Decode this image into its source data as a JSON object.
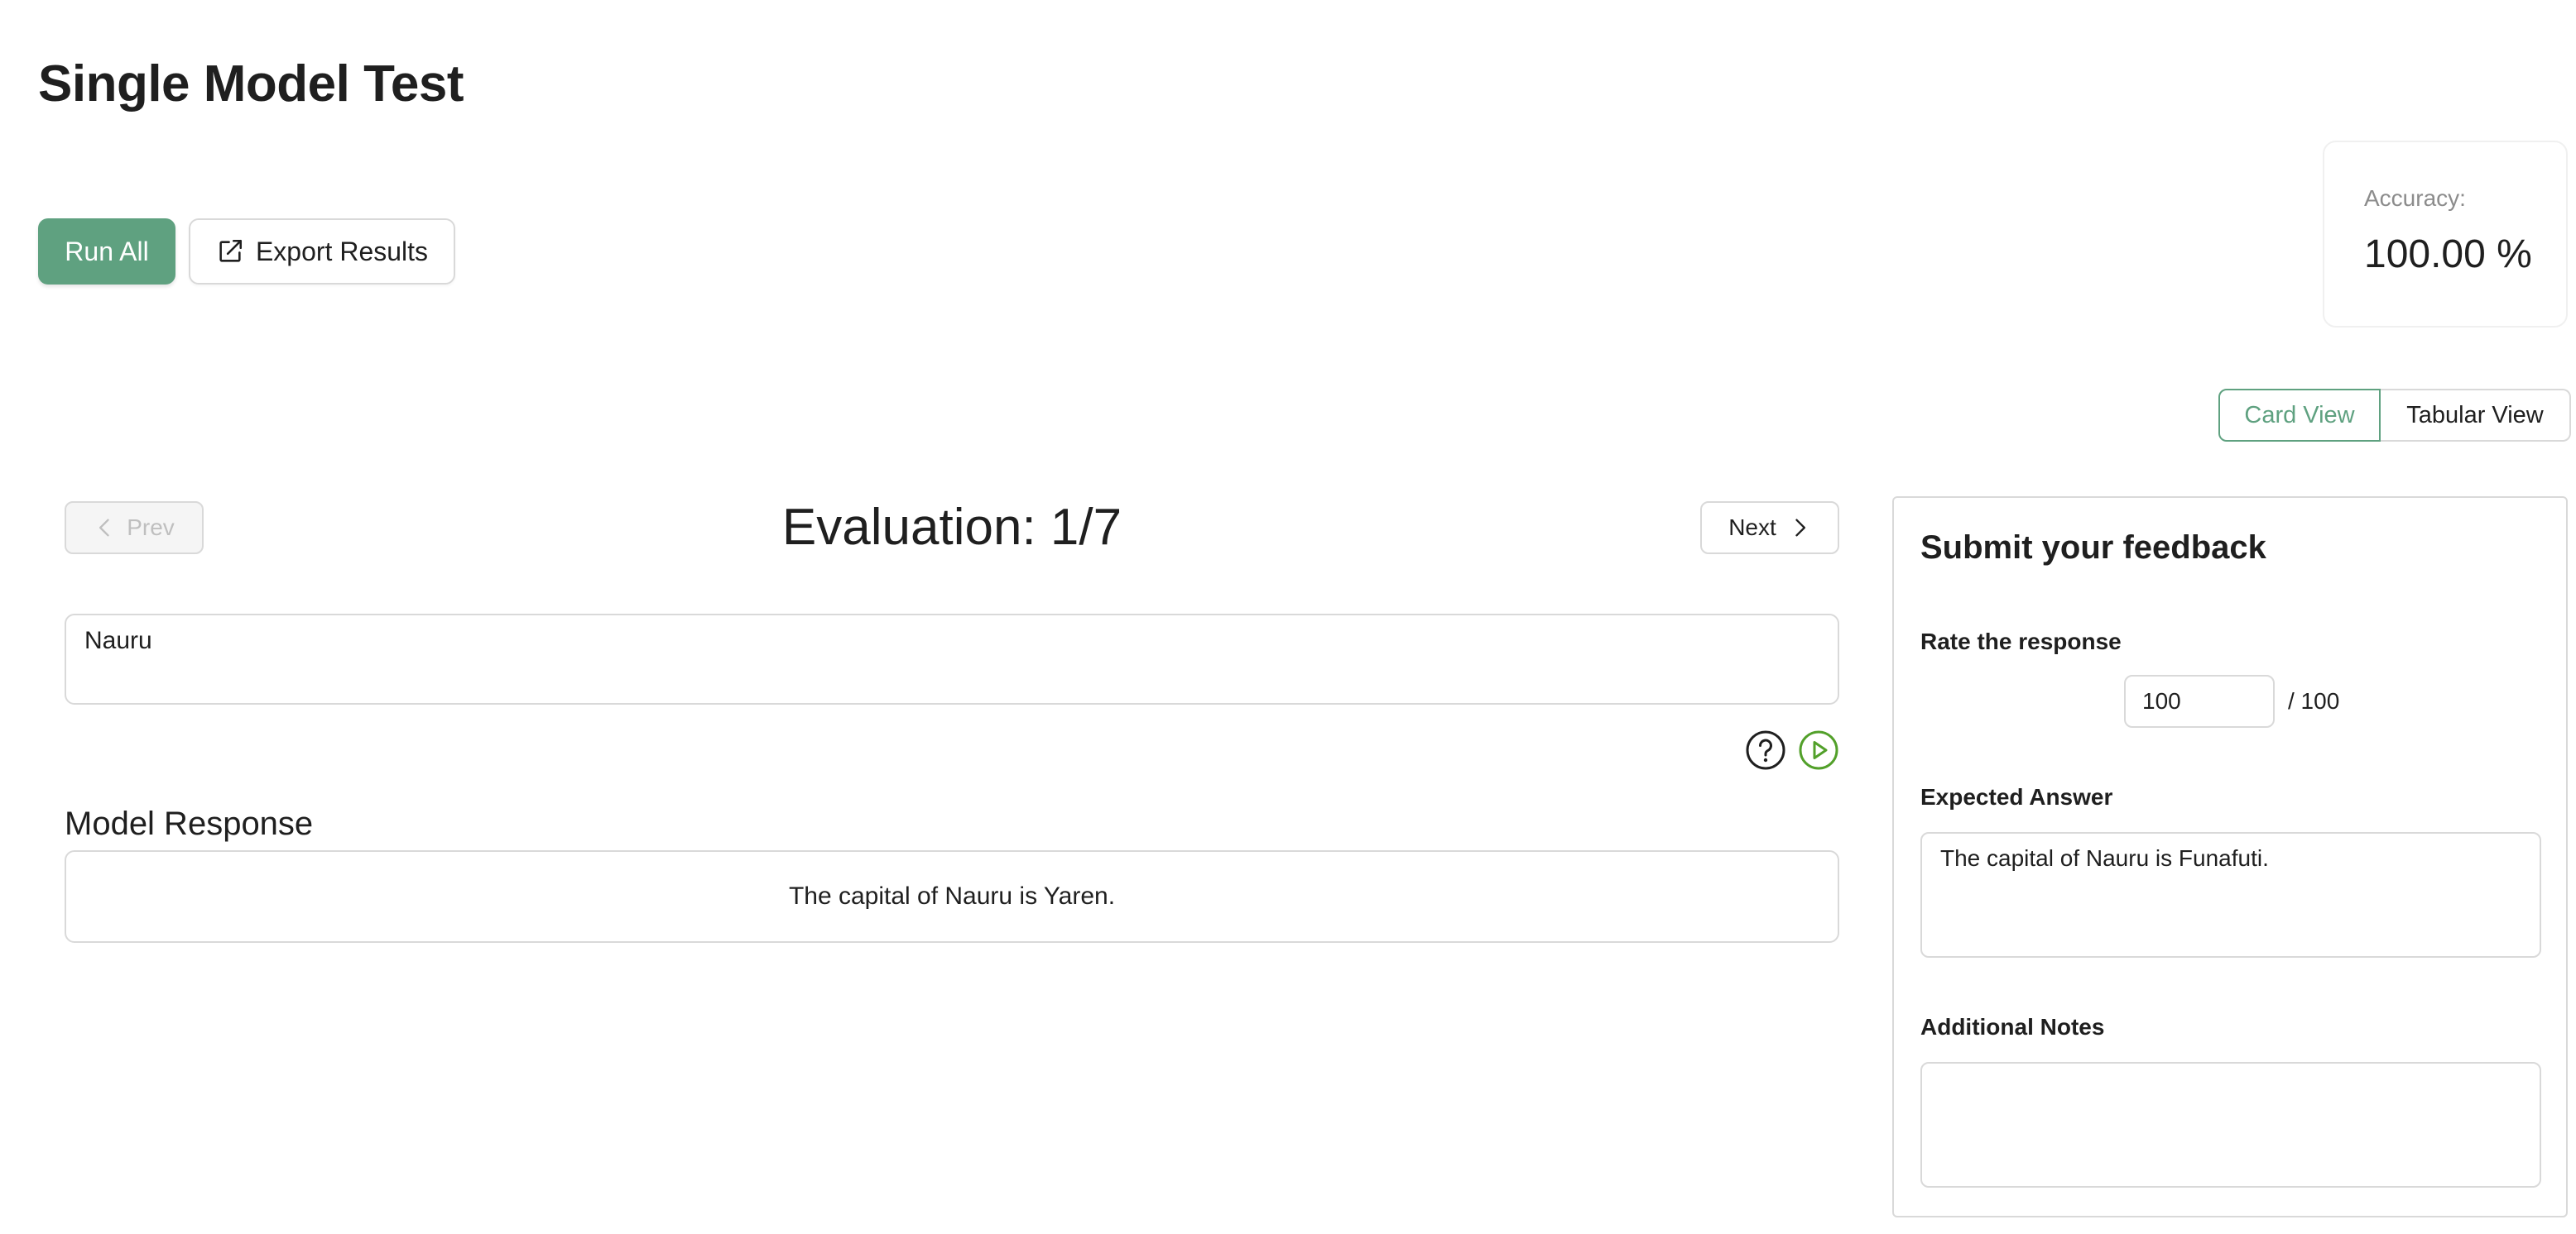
{
  "page": {
    "title": "Single Model Test"
  },
  "toolbar": {
    "run_all_label": "Run All",
    "export_label": "Export Results"
  },
  "accuracy": {
    "label": "Accuracy:",
    "value": "100.00 %"
  },
  "view_toggle": {
    "card_label": "Card View",
    "tabular_label": "Tabular View",
    "selected": "Card View"
  },
  "evaluation": {
    "prev_label": "Prev",
    "next_label": "Next",
    "title": "Evaluation: 1/7",
    "prompt": "Nauru",
    "response_heading": "Model Response",
    "response": "The capital of Nauru is Yaren."
  },
  "feedback": {
    "title": "Submit your feedback",
    "rate_label": "Rate the response",
    "rate_value": "100",
    "rate_max": "/ 100",
    "expected_label": "Expected Answer",
    "expected_value": "The capital of Nauru is Funafuti.",
    "notes_label": "Additional Notes",
    "notes_value": ""
  },
  "icons": {
    "export": "external-link-icon",
    "prev": "chevron-left-icon",
    "next": "chevron-right-icon",
    "help": "question-circle-icon",
    "play": "play-circle-icon"
  },
  "colors": {
    "accent": "#5fa180",
    "play_icon": "#52a02a",
    "border": "#d9d9d9",
    "muted_text": "#8c8c8c"
  }
}
